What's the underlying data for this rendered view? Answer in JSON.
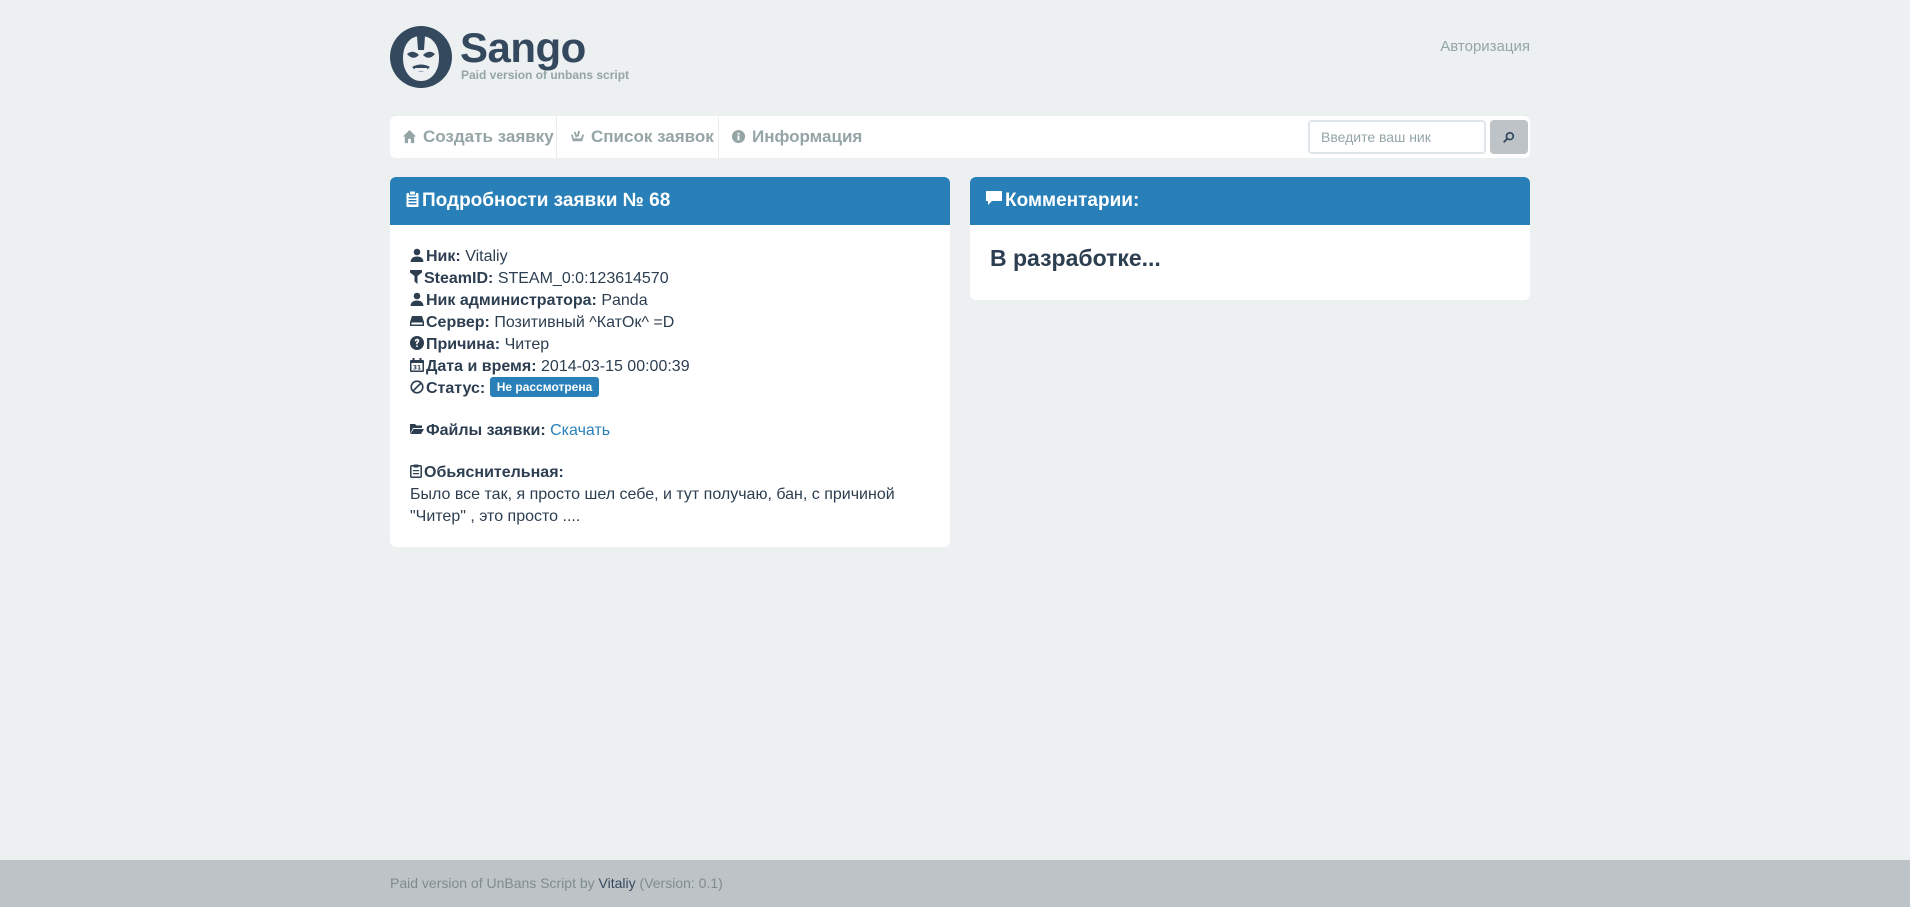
{
  "header": {
    "brand": "Sango",
    "tagline": "Paid version of unbans script",
    "auth_link": "Авторизация"
  },
  "nav": {
    "items": [
      {
        "label": "Создать заявку",
        "icon": "home-icon"
      },
      {
        "label": "Список заявок",
        "icon": "list-icon"
      },
      {
        "label": "Информация",
        "icon": "info-icon"
      }
    ],
    "search_placeholder": "Введите ваш ник",
    "search_value": ""
  },
  "details_panel": {
    "title": "Подробности заявки № 68",
    "fields": {
      "nick_label": "Ник:",
      "nick_value": "Vitaliy",
      "steamid_label": "SteamID:",
      "steamid_value": "STEAM_0:0:123614570",
      "admin_label": "Ник администратора:",
      "admin_value": "Panda",
      "server_label": "Сервер:",
      "server_value": "Позитивный ^КатОк^ =D",
      "reason_label": "Причина:",
      "reason_value": "Читер",
      "datetime_label": "Дата и время:",
      "datetime_value": "2014-03-15 00:00:39",
      "status_label": "Статус:",
      "status_value": "Не рассмотрена",
      "files_label": "Файлы заявки:",
      "files_link": "Скачать",
      "explain_label": "Обьяснительная:",
      "explain_text": "Было все так, я просто шел себе, и тут получаю, бан, с причиной \"Читер\" , это просто ...."
    }
  },
  "comments_panel": {
    "title": "Комментарии:",
    "body": "В разработке..."
  },
  "footer": {
    "prefix": "Paid version of UnBans Script by ",
    "author": "Vitaliy",
    "version": " (Version: 0.1)"
  },
  "colors": {
    "background": "#ecf0f1",
    "accent": "#2980b9",
    "text": "#2c3e50",
    "muted": "#95a5a6",
    "footer": "#bdc3c7"
  }
}
